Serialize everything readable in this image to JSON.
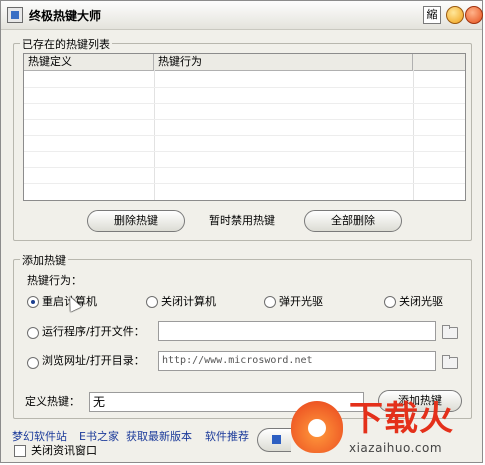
{
  "window": {
    "title": "终极热键大师",
    "shrink_label": "縮"
  },
  "hotkey_list": {
    "legend": "已存在的热键列表",
    "columns": [
      "热键定义",
      "热键行为",
      ""
    ],
    "delete_label": "删除热键",
    "disable_label": "暂时禁用热键",
    "delete_all_label": "全部删除"
  },
  "add_hotkey": {
    "legend": "添加热键",
    "behavior_label": "热键行为：",
    "options": [
      "重启计算机",
      "关闭计算机",
      "弹开光驱",
      "关闭光驱"
    ],
    "selected": "重启计算机",
    "run_program_label": "运行程序/打开文件：",
    "browse_url_label": "浏览网址/打开目录：",
    "url_placeholder": "http://www.microsword.net",
    "define_label": "定义热键：",
    "define_value": "无",
    "add_button_label": "添加热键"
  },
  "footer": {
    "links": [
      "梦幻软件站",
      "E书之家",
      "获取最新版本",
      "软件推荐"
    ],
    "close_info_label": "关闭资讯窗口"
  },
  "watermark": {
    "brand": "下载火",
    "url": "xiazaihuo.com"
  }
}
